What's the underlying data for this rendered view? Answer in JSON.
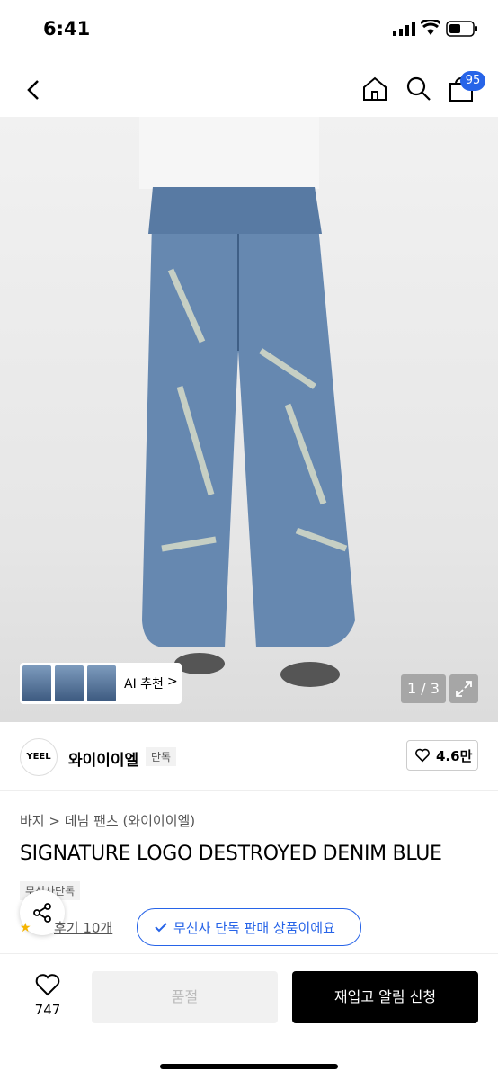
{
  "status_bar": {
    "time": "6:41"
  },
  "nav": {
    "cart_count": "95"
  },
  "gallery": {
    "ai_label": "AI 추천",
    "ai_chevron": ">",
    "pager": "1 / 3"
  },
  "brand": {
    "logo_text": "YEEL",
    "name": "와이이이엘",
    "tag": "단독",
    "likes": "4.6만"
  },
  "product": {
    "breadcrumb": "바지 > 데님 팬츠 (와이이이엘)",
    "title": "SIGNATURE LOGO DESTROYED DENIM BLUE",
    "exclusive_tag": "무신사단독",
    "review_link": "후기 10개",
    "exclusive_pill": "무신사 단독 판매 상품이에요"
  },
  "bottom_bar": {
    "like_count": "747",
    "soldout_label": "품절",
    "restock_label": "재입고 알림 신청"
  },
  "colors": {
    "accent": "#2764e8",
    "primary": "#000000"
  }
}
